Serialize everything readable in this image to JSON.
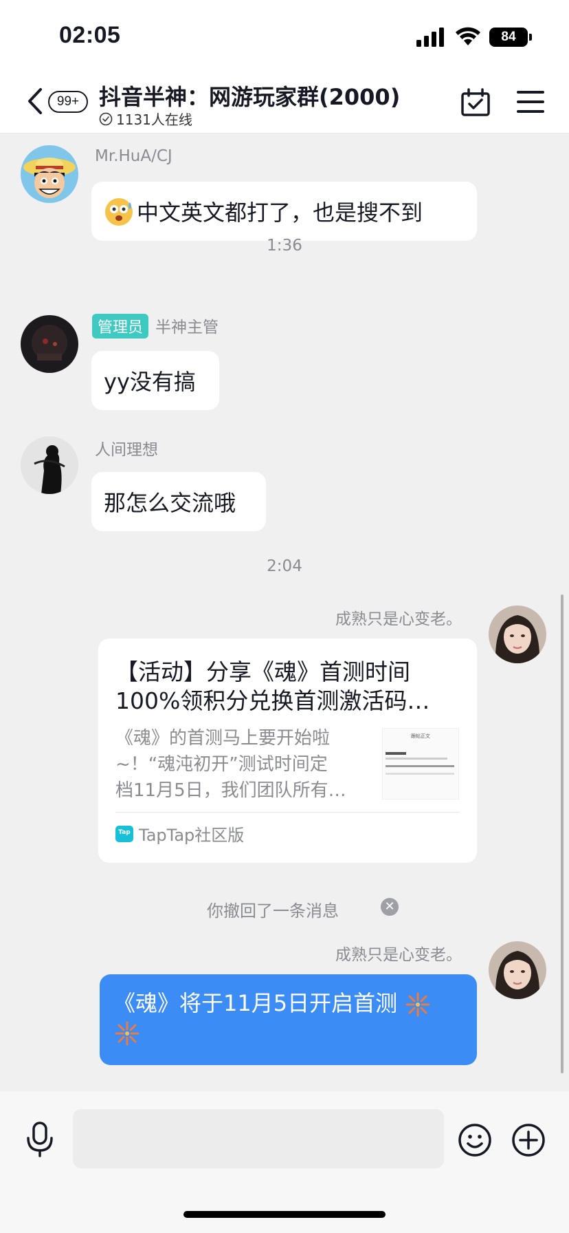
{
  "status": {
    "time": "02:05",
    "battery": "84"
  },
  "header": {
    "unread_badge": "99+",
    "title": "抖音半神：网游玩家群(2000)",
    "online": "1131人在线"
  },
  "messages": [
    {
      "sender": "Mr.HuA/CJ",
      "text": "中文英文都打了，也是搜不到"
    },
    {
      "timestamp": "1:36"
    },
    {
      "role_tag": "管理员",
      "sender": "半神主管",
      "text": "yy没有搞"
    },
    {
      "sender": "人间理想",
      "text": "那怎么交流哦"
    },
    {
      "timestamp": "2:04"
    },
    {
      "sender": "成熟只是心变老。",
      "card": {
        "title_line1": "【活动】分享《魂》首测时间",
        "title_line2": "100%领积分兑换首测激活码…",
        "desc_line1": "《魂》的首测马上要开始啦",
        "desc_line2": "~！“魂沌初开”测试时间定",
        "desc_line3": "档11月5日，我们团队所有…",
        "thumb_title": "跟帖正文",
        "source": "TapTap社区版"
      }
    },
    {
      "recall_notice": "你撤回了一条消息"
    },
    {
      "sender": "成熟只是心变老。",
      "text": "《魂》将于11月5日开启首测"
    }
  ],
  "colors": {
    "accent_blue": "#3b8cf5",
    "admin_tag": "#3ecac1",
    "bg": "#f0f0f0"
  }
}
